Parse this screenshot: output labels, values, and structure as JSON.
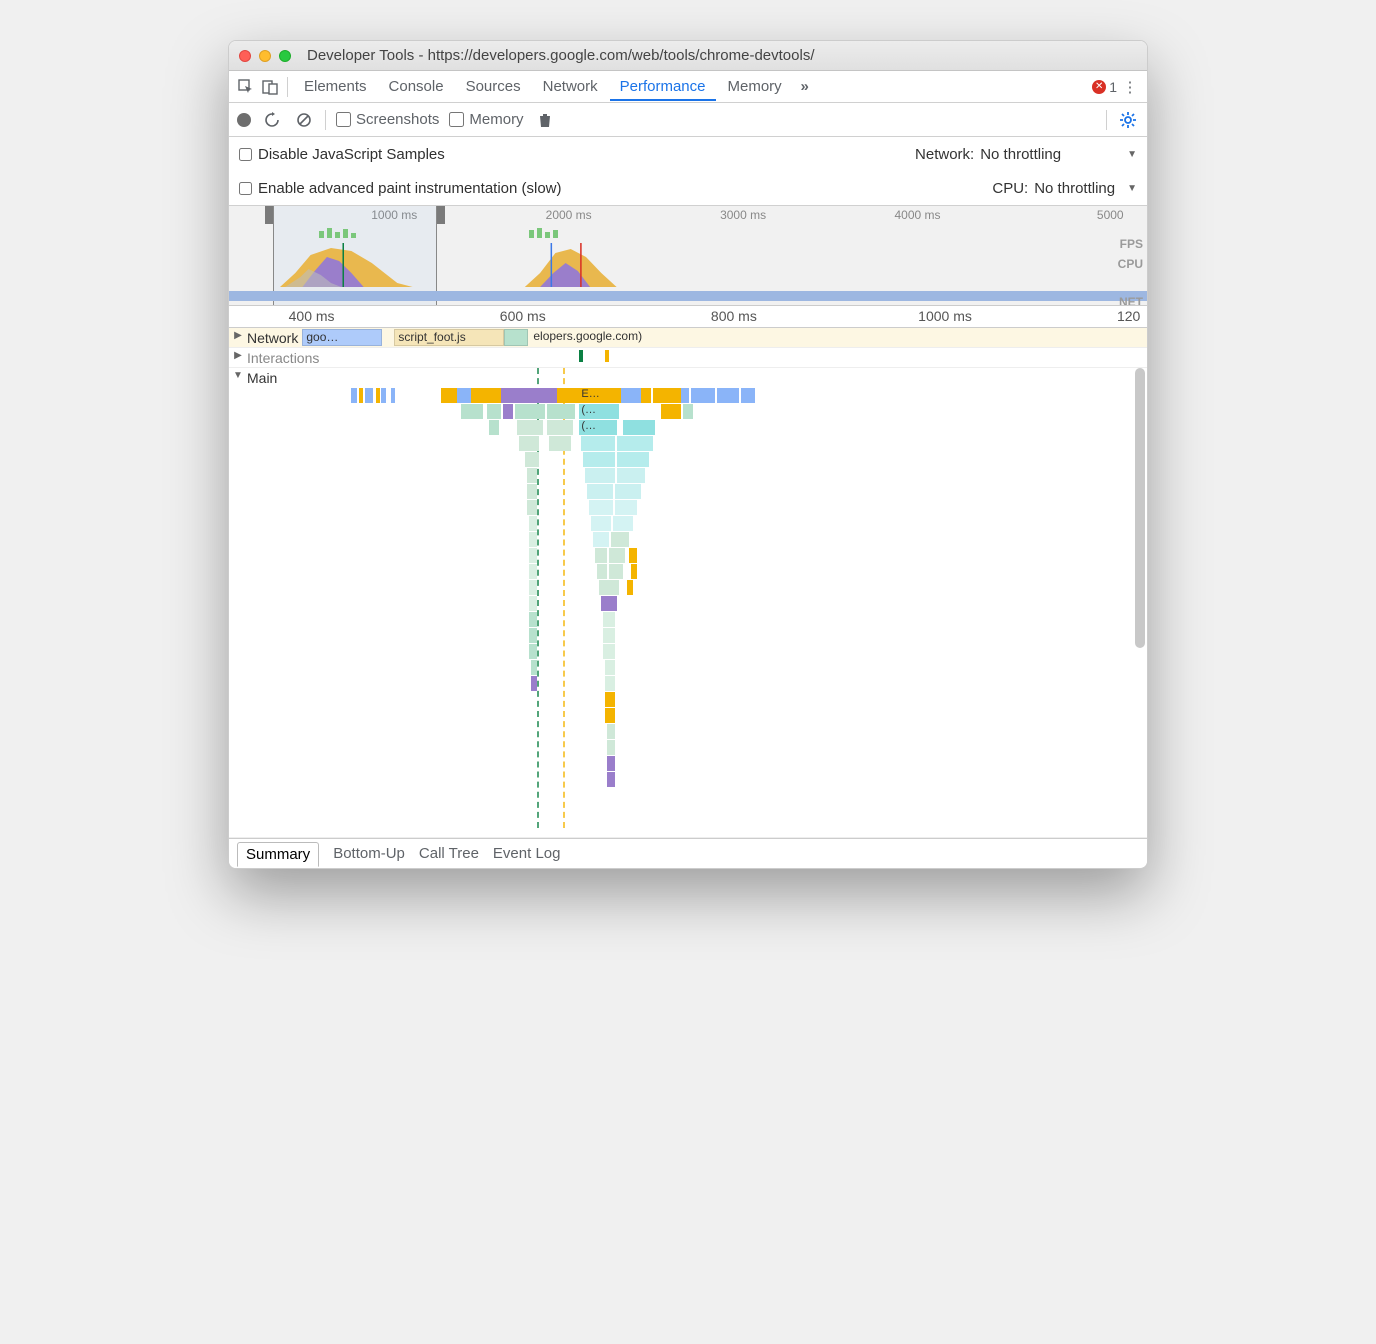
{
  "window": {
    "title": "Developer Tools - https://developers.google.com/web/tools/chrome-devtools/"
  },
  "tabs": {
    "items": [
      "Elements",
      "Console",
      "Sources",
      "Network",
      "Performance",
      "Memory"
    ],
    "active": "Performance",
    "error_count": "1"
  },
  "toolbar": {
    "screenshots_label": "Screenshots",
    "memory_label": "Memory"
  },
  "settings": {
    "disable_js_label": "Disable JavaScript Samples",
    "paint_instr_label": "Enable advanced paint instrumentation (slow)",
    "network_label": "Network:",
    "network_value": "No throttling",
    "cpu_label": "CPU:",
    "cpu_value": "No throttling"
  },
  "overview": {
    "ticks": [
      "1000 ms",
      "2000 ms",
      "3000 ms",
      "4000 ms",
      "5000"
    ],
    "lanes": {
      "fps": "FPS",
      "cpu": "CPU",
      "net": "NET"
    }
  },
  "ruler": {
    "ticks": [
      "400 ms",
      "600 ms",
      "800 ms",
      "1000 ms",
      "120"
    ]
  },
  "tracks": {
    "network_label": "Network",
    "network_items": {
      "goo": "goo…",
      "script": "script_foot.js",
      "tail": "elopers.google.com)"
    },
    "interactions_label": "Interactions",
    "main_label": "Main",
    "flame_labels": {
      "e": "E…",
      "p1": "(…",
      "p2": "(…"
    }
  },
  "bottom": {
    "tabs": [
      "Summary",
      "Bottom-Up",
      "Call Tree",
      "Event Log"
    ],
    "active": "Summary"
  }
}
